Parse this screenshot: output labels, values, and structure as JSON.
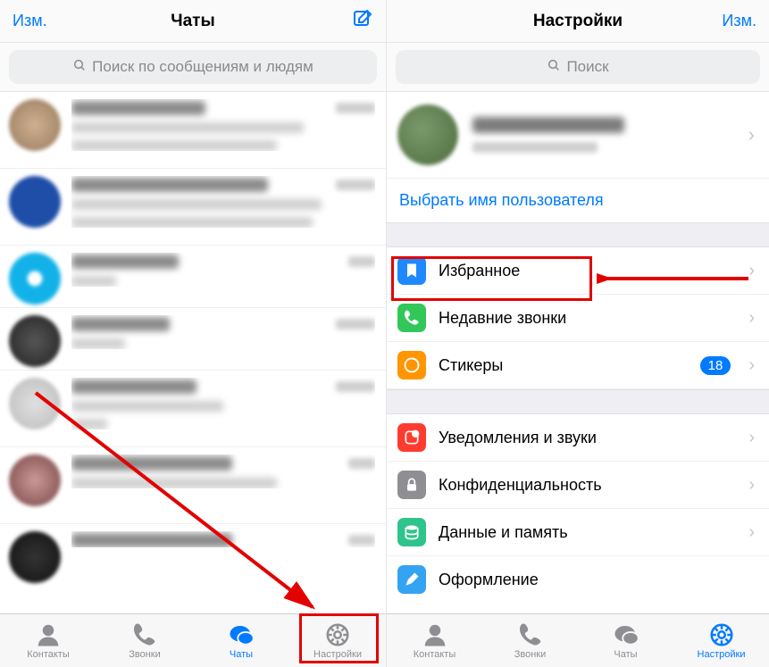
{
  "left": {
    "header": {
      "edit": "Изм.",
      "title": "Чаты"
    },
    "search": {
      "placeholder": "Поиск по сообщениям и людям"
    },
    "tabs": {
      "contacts": "Контакты",
      "calls": "Звонки",
      "chats": "Чаты",
      "settings": "Настройки"
    }
  },
  "right": {
    "header": {
      "title": "Настройки",
      "edit": "Изм."
    },
    "search": {
      "placeholder": "Поиск"
    },
    "choose_username": "Выбрать имя пользователя",
    "cells": {
      "favorites": "Избранное",
      "recent_calls": "Недавние звонки",
      "stickers": "Стикеры",
      "stickers_badge": "18",
      "notifications": "Уведомления и звуки",
      "privacy": "Конфиденциальность",
      "data": "Данные и память",
      "appearance": "Оформление"
    },
    "tabs": {
      "contacts": "Контакты",
      "calls": "Звонки",
      "chats": "Чаты",
      "settings": "Настройки"
    }
  }
}
